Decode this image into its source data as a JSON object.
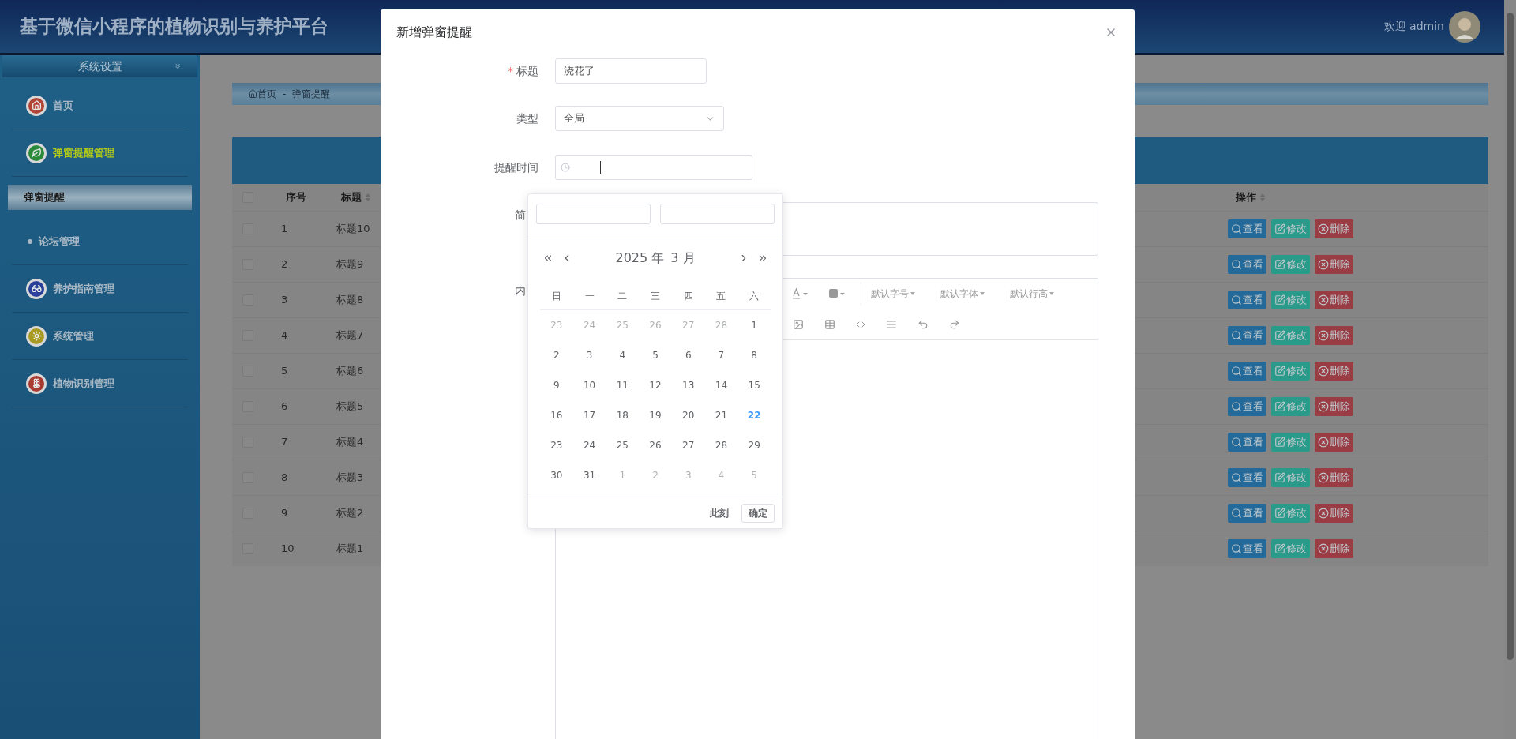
{
  "header": {
    "title": "基于微信小程序的植物识别与养护平台",
    "welcome": "欢迎 admin"
  },
  "sidebar": {
    "heading": "系统设置",
    "items": [
      {
        "label": "首页",
        "kind": "icon",
        "color": "#b04535",
        "active": false
      },
      {
        "label": "弹窗提醒管理",
        "kind": "icon",
        "color": "#2a8a3a",
        "active": true,
        "children": [
          {
            "label": "弹窗提醒",
            "selected": true
          }
        ]
      },
      {
        "label": "论坛管理",
        "kind": "bullet",
        "active": false
      },
      {
        "label": "养护指南管理",
        "kind": "icon",
        "color": "#2a3f9a",
        "active": false
      },
      {
        "label": "系统管理",
        "kind": "icon",
        "color": "#a89a20",
        "active": false
      },
      {
        "label": "植物识别管理",
        "kind": "icon",
        "color": "#a83a30",
        "active": false
      }
    ]
  },
  "breadcrumb": {
    "items": [
      "首页",
      "弹窗提醒"
    ],
    "separator": "-"
  },
  "table": {
    "columns": [
      {
        "label": "序号",
        "sortable": false
      },
      {
        "label": "标题",
        "sortable": true
      },
      {
        "label": "操作",
        "sortable": true
      }
    ],
    "header_checked": false,
    "rows": [
      {
        "index": "1",
        "title": "标题10",
        "checked": false,
        "actions": [
          {
            "kind": "view",
            "label": "查看"
          },
          {
            "kind": "edit",
            "label": "修改"
          },
          {
            "kind": "delete",
            "label": "删除"
          }
        ]
      },
      {
        "index": "2",
        "title": "标题9",
        "checked": false,
        "actions": [
          {
            "kind": "view",
            "label": "查看"
          },
          {
            "kind": "edit",
            "label": "修改"
          },
          {
            "kind": "delete",
            "label": "删除"
          }
        ]
      },
      {
        "index": "3",
        "title": "标题8",
        "checked": false,
        "actions": [
          {
            "kind": "view",
            "label": "查看"
          },
          {
            "kind": "edit",
            "label": "修改"
          },
          {
            "kind": "delete",
            "label": "删除"
          }
        ]
      },
      {
        "index": "4",
        "title": "标题7",
        "checked": false,
        "actions": [
          {
            "kind": "view",
            "label": "查看"
          },
          {
            "kind": "edit",
            "label": "修改"
          },
          {
            "kind": "delete",
            "label": "删除"
          }
        ]
      },
      {
        "index": "5",
        "title": "标题6",
        "checked": false,
        "actions": [
          {
            "kind": "view",
            "label": "查看"
          },
          {
            "kind": "edit",
            "label": "修改"
          },
          {
            "kind": "delete",
            "label": "删除"
          }
        ]
      },
      {
        "index": "6",
        "title": "标题5",
        "checked": false,
        "actions": [
          {
            "kind": "view",
            "label": "查看"
          },
          {
            "kind": "edit",
            "label": "修改"
          },
          {
            "kind": "delete",
            "label": "删除"
          }
        ]
      },
      {
        "index": "7",
        "title": "标题4",
        "checked": false,
        "actions": [
          {
            "kind": "view",
            "label": "查看"
          },
          {
            "kind": "edit",
            "label": "修改"
          },
          {
            "kind": "delete",
            "label": "删除"
          }
        ]
      },
      {
        "index": "8",
        "title": "标题3",
        "checked": false,
        "actions": [
          {
            "kind": "view",
            "label": "查看"
          },
          {
            "kind": "edit",
            "label": "修改"
          },
          {
            "kind": "delete",
            "label": "删除"
          }
        ]
      },
      {
        "index": "9",
        "title": "标题2",
        "checked": false,
        "actions": [
          {
            "kind": "view",
            "label": "查看"
          },
          {
            "kind": "edit",
            "label": "修改"
          },
          {
            "kind": "delete",
            "label": "删除"
          }
        ]
      },
      {
        "index": "10",
        "title": "标题1",
        "checked": false,
        "actions": [
          {
            "kind": "view",
            "label": "查看"
          },
          {
            "kind": "edit",
            "label": "修改"
          },
          {
            "kind": "delete",
            "label": "删除"
          }
        ]
      }
    ]
  },
  "dialog": {
    "title": "新增弹窗提醒",
    "required_mark": "*",
    "fields": [
      {
        "kind": "text",
        "label": "标题",
        "required": true,
        "value": "浇花了"
      },
      {
        "kind": "select",
        "label": "类型",
        "required": false,
        "value": "全局"
      },
      {
        "kind": "datetime",
        "label": "提醒时间",
        "required": false,
        "focused": true
      },
      {
        "kind": "textarea",
        "label": "简",
        "required": false
      },
      {
        "kind": "editor",
        "label": "内",
        "required": false,
        "menus": [
          "默认字号",
          "默认字体",
          "默认行高"
        ]
      }
    ]
  },
  "date_picker": {
    "year": "2025 年",
    "month": "3 月",
    "weekdays": [
      "日",
      "一",
      "二",
      "三",
      "四",
      "五",
      "六"
    ],
    "weeks": [
      [
        {
          "day": "23",
          "other_month": true,
          "hovered": false
        },
        {
          "day": "24",
          "other_month": true,
          "hovered": false
        },
        {
          "day": "25",
          "other_month": true,
          "hovered": false
        },
        {
          "day": "26",
          "other_month": true,
          "hovered": false
        },
        {
          "day": "27",
          "other_month": true,
          "hovered": false
        },
        {
          "day": "28",
          "other_month": true,
          "hovered": false
        },
        {
          "day": "1",
          "other_month": false,
          "hovered": false
        }
      ],
      [
        {
          "day": "2",
          "other_month": false,
          "hovered": false
        },
        {
          "day": "3",
          "other_month": false,
          "hovered": false
        },
        {
          "day": "4",
          "other_month": false,
          "hovered": false
        },
        {
          "day": "5",
          "other_month": false,
          "hovered": false
        },
        {
          "day": "6",
          "other_month": false,
          "hovered": false
        },
        {
          "day": "7",
          "other_month": false,
          "hovered": false
        },
        {
          "day": "8",
          "other_month": false,
          "hovered": false
        }
      ],
      [
        {
          "day": "9",
          "other_month": false,
          "hovered": false
        },
        {
          "day": "10",
          "other_month": false,
          "hovered": false
        },
        {
          "day": "11",
          "other_month": false,
          "hovered": false
        },
        {
          "day": "12",
          "other_month": false,
          "hovered": false
        },
        {
          "day": "13",
          "other_month": false,
          "hovered": false
        },
        {
          "day": "14",
          "other_month": false,
          "hovered": false
        },
        {
          "day": "15",
          "other_month": false,
          "hovered": false
        }
      ],
      [
        {
          "day": "16",
          "other_month": false,
          "hovered": false
        },
        {
          "day": "17",
          "other_month": false,
          "hovered": false
        },
        {
          "day": "18",
          "other_month": false,
          "hovered": false
        },
        {
          "day": "19",
          "other_month": false,
          "hovered": false
        },
        {
          "day": "20",
          "other_month": false,
          "hovered": false
        },
        {
          "day": "21",
          "other_month": false,
          "hovered": false
        },
        {
          "day": "22",
          "other_month": false,
          "hovered": true
        }
      ],
      [
        {
          "day": "23",
          "other_month": false,
          "hovered": false
        },
        {
          "day": "24",
          "other_month": false,
          "hovered": false
        },
        {
          "day": "25",
          "other_month": false,
          "hovered": false
        },
        {
          "day": "26",
          "other_month": false,
          "hovered": false
        },
        {
          "day": "27",
          "other_month": false,
          "hovered": false
        },
        {
          "day": "28",
          "other_month": false,
          "hovered": false
        },
        {
          "day": "29",
          "other_month": false,
          "hovered": false
        }
      ],
      [
        {
          "day": "30",
          "other_month": false,
          "hovered": false
        },
        {
          "day": "31",
          "other_month": false,
          "hovered": false
        },
        {
          "day": "1",
          "other_month": true,
          "hovered": false
        },
        {
          "day": "2",
          "other_month": true,
          "hovered": false
        },
        {
          "day": "3",
          "other_month": true,
          "hovered": false
        },
        {
          "day": "4",
          "other_month": true,
          "hovered": false
        },
        {
          "day": "5",
          "other_month": true,
          "hovered": false
        }
      ]
    ],
    "now_button": "此刻",
    "confirm_button": "确定"
  }
}
